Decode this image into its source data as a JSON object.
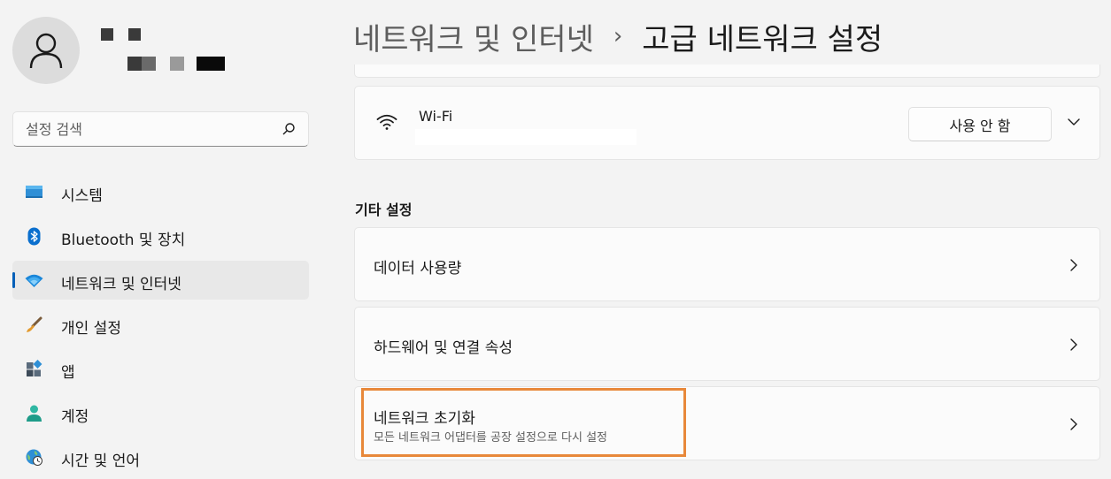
{
  "sidebar": {
    "search": {
      "placeholder": "설정 검색"
    },
    "items": [
      {
        "label": "시스템",
        "icon": "system-icon",
        "active": false
      },
      {
        "label": "Bluetooth 및 장치",
        "icon": "bluetooth-icon",
        "active": false
      },
      {
        "label": "네트워크 및 인터넷",
        "icon": "network-icon",
        "active": true
      },
      {
        "label": "개인 설정",
        "icon": "brush-icon",
        "active": false
      },
      {
        "label": "앱",
        "icon": "apps-icon",
        "active": false
      },
      {
        "label": "계정",
        "icon": "account-icon",
        "active": false
      },
      {
        "label": "시간 및 언어",
        "icon": "time-language-icon",
        "active": false
      }
    ]
  },
  "header": {
    "parent": "네트워크 및 인터넷",
    "separator": "›",
    "current": "고급 네트워크 설정"
  },
  "wifi": {
    "name": "Wi-Fi",
    "button_label": "사용 안 함"
  },
  "other_settings": {
    "title": "기타 설정",
    "rows": [
      {
        "title": "데이터 사용량"
      },
      {
        "title": "하드웨어 및 연결 속성"
      },
      {
        "title": "네트워크 초기화",
        "subtitle": "모든 네트워크 어댑터를 공장 설정으로 다시 설정"
      }
    ]
  },
  "colors": {
    "accent": "#005fb8",
    "highlight": "#e8883a"
  }
}
